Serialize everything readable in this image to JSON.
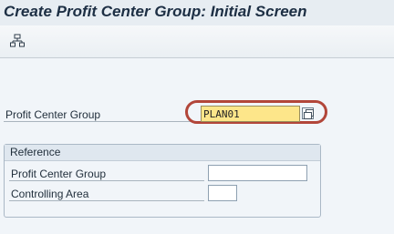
{
  "window": {
    "title": "Create Profit Center Group: Initial Screen"
  },
  "toolbar": {
    "hierarchy_icon": "hierarchy-icon"
  },
  "main": {
    "profit_center_group_label": "Profit Center Group",
    "profit_center_group_value": "PLAN01",
    "value_help_icon": "value-help-icon"
  },
  "reference": {
    "title": "Reference",
    "profit_center_group_label": "Profit Center Group",
    "profit_center_group_value": "",
    "controlling_area_label": "Controlling Area",
    "controlling_area_value": ""
  },
  "colors": {
    "required_field": "#fde68a",
    "highlight_ring": "#b2463a"
  }
}
